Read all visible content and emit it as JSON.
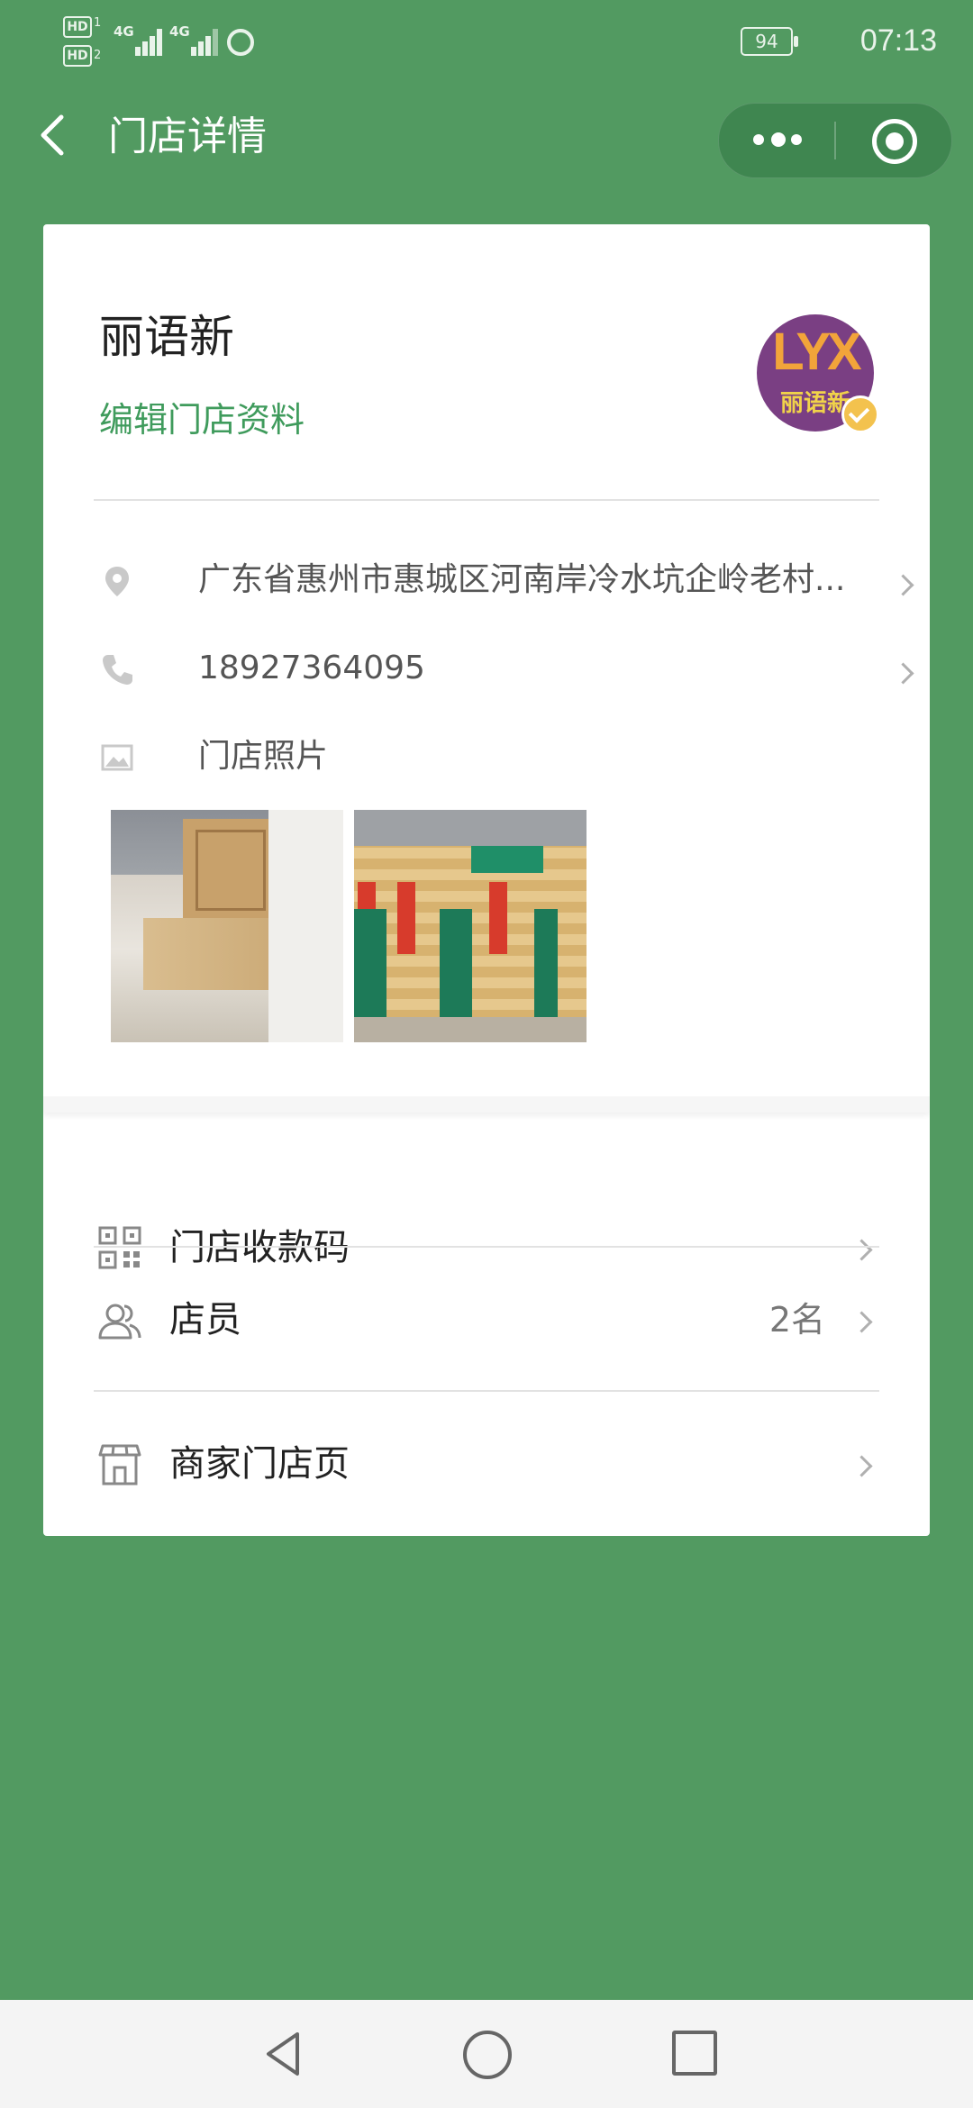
{
  "status_bar": {
    "hd1": "HD",
    "hd1_num": "1",
    "hd2": "HD",
    "hd2_num": "2",
    "network1": "4G",
    "network2": "4G",
    "battery": "94",
    "time": "07:13"
  },
  "nav": {
    "title": "门店详情"
  },
  "store": {
    "name": "丽语新",
    "edit_link": "编辑门店资料",
    "logo_text_top": "LYX",
    "logo_text_bottom": "丽语新",
    "address": "广东省惠州市惠城区河南岸冷水坑企岭老村...",
    "phone": "18927364095",
    "photos_label": "门店照片"
  },
  "menu": {
    "items": [
      {
        "label": "门店收款码",
        "value": "",
        "icon": "qr-code-icon"
      },
      {
        "label": "店员",
        "value": "2名",
        "icon": "people-icon"
      },
      {
        "label": "商家门店页",
        "value": "",
        "icon": "shop-icon"
      }
    ]
  },
  "colors": {
    "background": "#529a61",
    "accent": "#3f9b5c"
  }
}
